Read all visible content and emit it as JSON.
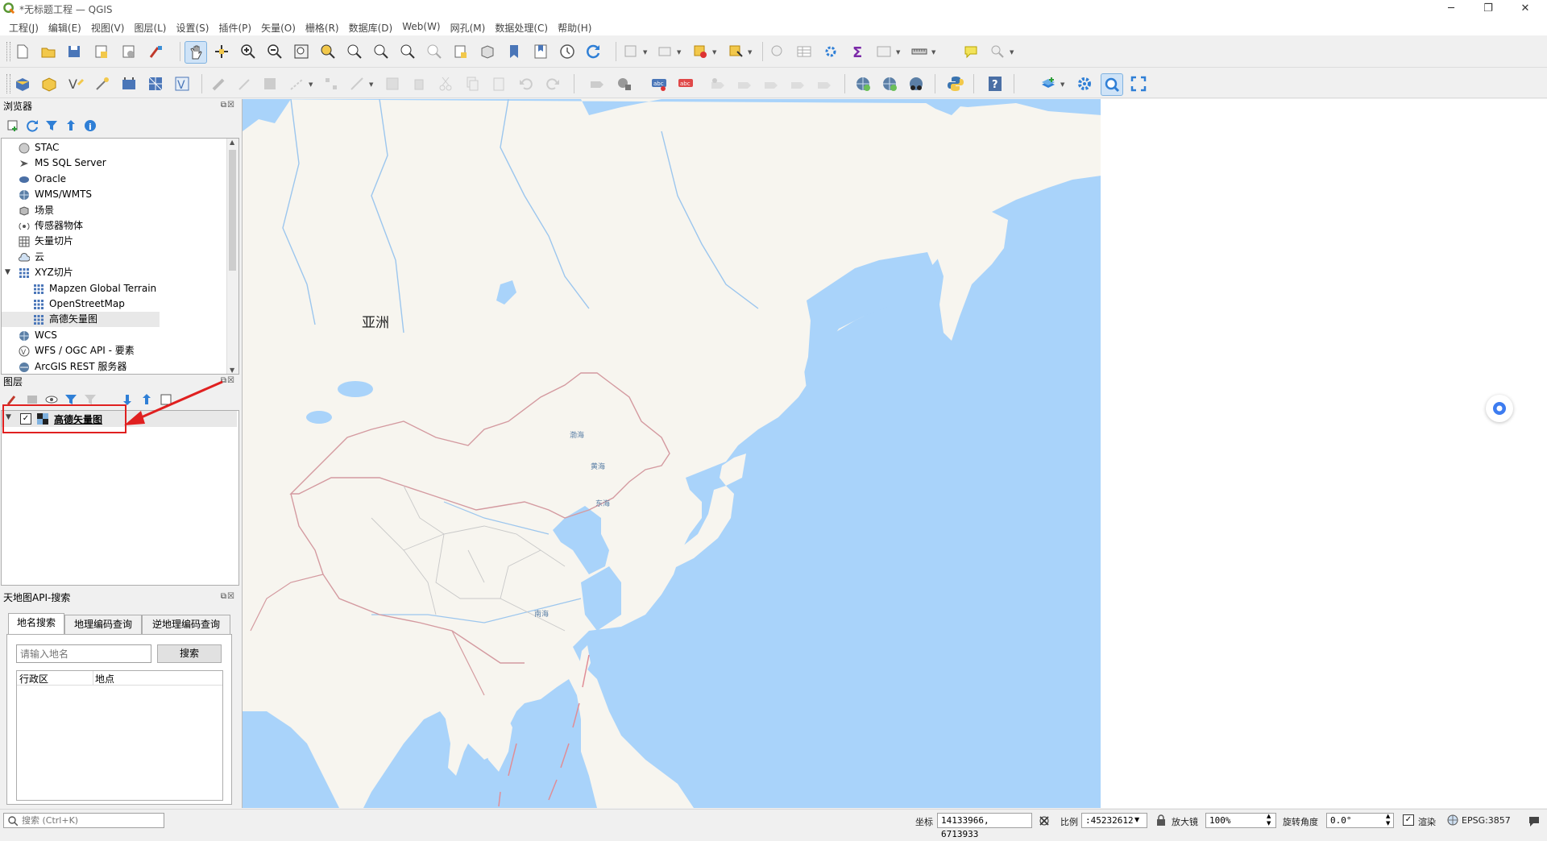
{
  "window": {
    "title": "*无标题工程 — QGIS",
    "minimize": "─",
    "maximize": "❐",
    "close": "✕"
  },
  "menu": [
    "工程(J)",
    "编辑(E)",
    "视图(V)",
    "图层(L)",
    "设置(S)",
    "插件(P)",
    "矢量(O)",
    "栅格(R)",
    "数据库(D)",
    "Web(W)",
    "网孔(M)",
    "数据处理(C)",
    "帮助(H)"
  ],
  "browser": {
    "title": "浏览器",
    "items": [
      {
        "label": "STAC",
        "icon": "stac-icon",
        "indent": 0
      },
      {
        "label": "MS SQL Server",
        "icon": "mssql-icon",
        "indent": 0
      },
      {
        "label": "Oracle",
        "icon": "oracle-icon",
        "indent": 0
      },
      {
        "label": "WMS/WMTS",
        "icon": "globe-icon",
        "indent": 0
      },
      {
        "label": "场景",
        "icon": "scene-icon",
        "indent": 0
      },
      {
        "label": "传感器物体",
        "icon": "sensor-icon",
        "indent": 0
      },
      {
        "label": "矢量切片",
        "icon": "vector-tile-icon",
        "indent": 0
      },
      {
        "label": "云",
        "icon": "cloud-icon",
        "indent": 0
      },
      {
        "label": "XYZ切片",
        "icon": "xyz-tile-icon",
        "indent": 0,
        "expanded": true
      },
      {
        "label": "Mapzen Global Terrain",
        "icon": "xyz-tile-icon",
        "indent": 1
      },
      {
        "label": "OpenStreetMap",
        "icon": "xyz-tile-icon",
        "indent": 1
      },
      {
        "label": "高德矢量图",
        "icon": "xyz-tile-icon",
        "indent": 1,
        "selected": true
      },
      {
        "label": "WCS",
        "icon": "globe-icon",
        "indent": 0
      },
      {
        "label": "WFS / OGC API - 要素",
        "icon": "wfs-icon",
        "indent": 0
      },
      {
        "label": "ArcGIS REST 服务器",
        "icon": "arcgis-icon",
        "indent": 0
      }
    ]
  },
  "layers": {
    "title": "图层",
    "items": [
      {
        "label": "高德矢量图",
        "checked": true
      }
    ]
  },
  "search_panel": {
    "title": "天地图API-搜索",
    "tabs": [
      "地名搜索",
      "地理编码查询",
      "逆地理编码查询"
    ],
    "input_placeholder": "请输入地名",
    "search_button": "搜索",
    "columns": [
      "行政区",
      "地点"
    ]
  },
  "map": {
    "labels": {
      "asia": "亚洲",
      "bohai": "渤海",
      "yellow_sea": "黄海",
      "east_sea": "东海",
      "south_sea": "南海"
    },
    "colors": {
      "land": "#f7f5ef",
      "water": "#a9d3fa",
      "border": "#d49aa0",
      "province": "#c8c8c8"
    }
  },
  "statusbar": {
    "search_placeholder": "搜索 (Ctrl+K)",
    "coord_label": "坐标",
    "coord_value": "14133966, 6713933",
    "scale_label": "比例",
    "scale_value": ":45232612",
    "magnifier_label": "放大镜",
    "magnifier_value": "100%",
    "rotation_label": "旋转角度",
    "rotation_value": "0.0°",
    "render_label": "渲染",
    "crs": "EPSG:3857"
  }
}
